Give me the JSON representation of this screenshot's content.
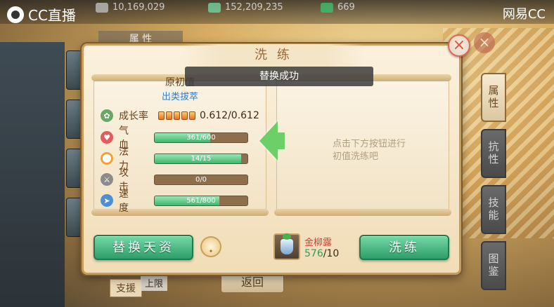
{
  "topbar": {
    "cc_label": "CC直播",
    "brand": "网易CC",
    "resources": [
      {
        "value": "10,169,029",
        "color": "#c9c9c9"
      },
      {
        "value": "152,209,235",
        "color": "#6fd4a0"
      },
      {
        "value": "669",
        "color": "#3cbf6c"
      }
    ]
  },
  "background": {
    "title": "属 性",
    "tabs": [
      "属性",
      "抗性",
      "技能",
      "图鉴"
    ],
    "tag_support": "支援",
    "tag_limit": "上限",
    "back_button": "返回"
  },
  "dialog": {
    "title": "洗 练",
    "close": "×",
    "toast": "替换成功",
    "left": {
      "header": "原初值",
      "quality": "出类拔萃",
      "growth": {
        "label": "成长率",
        "value": "0.612/0.612",
        "pips": 5
      },
      "stats": [
        {
          "label": "气 血",
          "text": "361/600",
          "fraction": 0.6,
          "icon_color": "#e35b5b",
          "icon": "heart-icon"
        },
        {
          "label": "法 力",
          "text": "14/15",
          "fraction": 0.93,
          "icon_color": "#f0a332",
          "icon": "mana-ring-icon"
        },
        {
          "label": "攻 击",
          "text": "0/0",
          "fraction": 0.0,
          "icon_color": "#8b8b8b",
          "icon": "sword-icon"
        },
        {
          "label": "速 度",
          "text": "561/800",
          "fraction": 0.7,
          "icon_color": "#4b8fd6",
          "icon": "boot-icon"
        }
      ]
    },
    "right_hint_line1": "点击下方按钮进行",
    "right_hint_line2": "初值洗练吧",
    "replace_button": "替换天资",
    "wash_button": "洗练",
    "item": {
      "name": "金柳露",
      "have": "576",
      "need": "/10"
    }
  }
}
